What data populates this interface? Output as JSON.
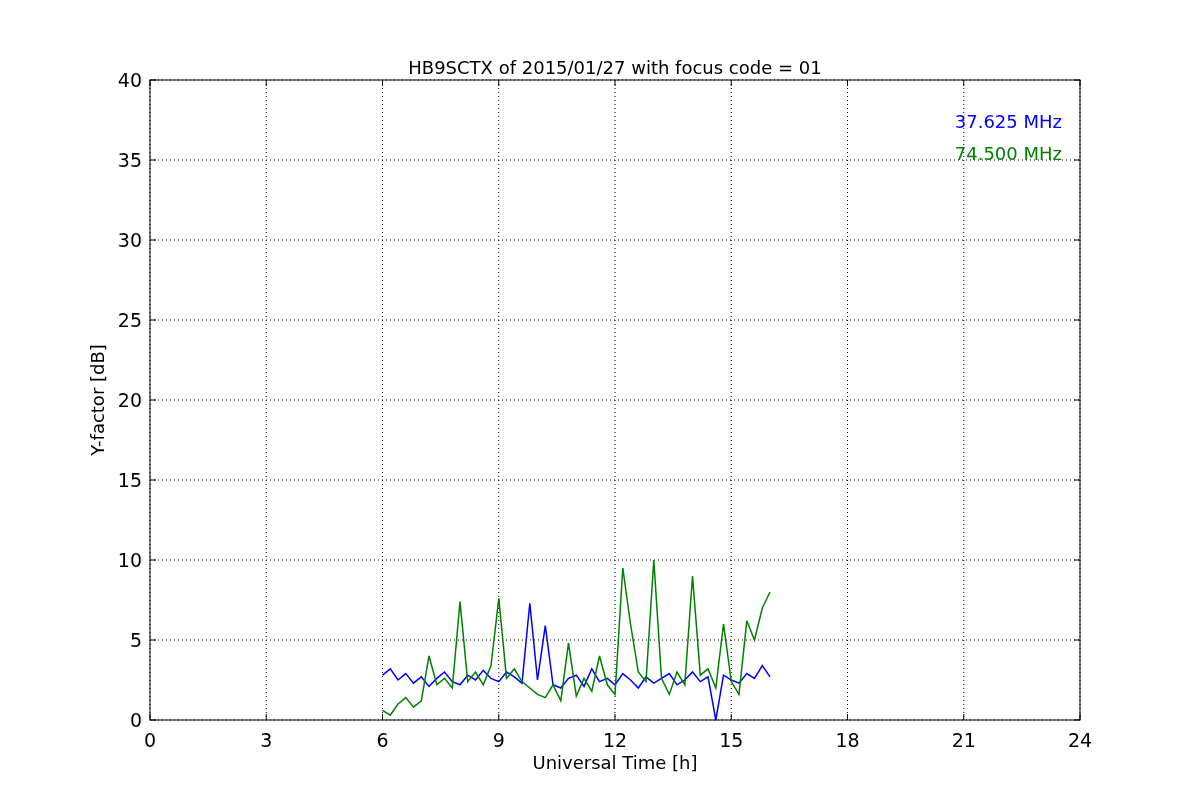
{
  "figure": {
    "chart_data": {
      "type": "line",
      "title": "HB9SCTX of 2015/01/27 with focus code = 01",
      "xlabel": "Universal Time [h]",
      "ylabel": "Y-factor [dB]",
      "x": [
        6.0,
        6.2,
        6.4,
        6.6,
        6.8,
        7.0,
        7.2,
        7.4,
        7.6,
        7.8,
        8.0,
        8.2,
        8.4,
        8.6,
        8.8,
        9.0,
        9.2,
        9.4,
        9.6,
        9.8,
        10.0,
        10.2,
        10.4,
        10.6,
        10.8,
        11.0,
        11.2,
        11.4,
        11.6,
        11.8,
        12.0,
        12.2,
        12.4,
        12.6,
        12.8,
        13.0,
        13.2,
        13.4,
        13.6,
        13.8,
        14.0,
        14.2,
        14.4,
        14.6,
        14.8,
        15.0,
        15.2,
        15.4,
        15.6,
        15.8,
        16.0
      ],
      "series": [
        {
          "name": "37.625 MHz",
          "color": "#0000ff",
          "values": [
            2.8,
            3.2,
            2.5,
            2.9,
            2.3,
            2.7,
            2.1,
            2.6,
            3.0,
            2.4,
            2.2,
            2.8,
            2.5,
            3.1,
            2.6,
            2.4,
            3.0,
            2.7,
            2.3,
            7.3,
            2.5,
            5.9,
            2.2,
            2.0,
            2.6,
            2.8,
            2.1,
            3.2,
            2.4,
            2.6,
            2.2,
            2.9,
            2.5,
            2.0,
            2.7,
            2.3,
            2.6,
            2.9,
            2.2,
            2.5,
            3.0,
            2.4,
            2.7,
            0.0,
            2.8,
            2.5,
            2.3,
            2.9,
            2.6,
            3.4,
            2.7
          ]
        },
        {
          "name": "74.500 MHz",
          "color": "#008000",
          "values": [
            0.6,
            0.3,
            1.0,
            1.4,
            0.8,
            1.2,
            4.0,
            2.2,
            2.6,
            2.0,
            7.4,
            2.4,
            3.0,
            2.2,
            3.4,
            7.6,
            2.6,
            3.2,
            2.4,
            2.0,
            1.6,
            1.4,
            2.2,
            1.2,
            4.8,
            1.5,
            2.6,
            1.8,
            4.0,
            2.2,
            1.6,
            9.5,
            6.0,
            3.0,
            2.4,
            10.0,
            2.6,
            1.6,
            3.0,
            2.2,
            9.0,
            2.8,
            3.2,
            2.0,
            6.0,
            2.4,
            1.6,
            6.2,
            5.0,
            7.0,
            8.0
          ]
        }
      ],
      "grid": true,
      "xlim": [
        0,
        24
      ],
      "ylim": [
        0,
        40
      ],
      "xticks": [
        0,
        3,
        6,
        9,
        12,
        15,
        18,
        21,
        24
      ],
      "yticks": [
        0,
        5,
        10,
        15,
        20,
        25,
        30,
        35,
        40
      ]
    }
  }
}
